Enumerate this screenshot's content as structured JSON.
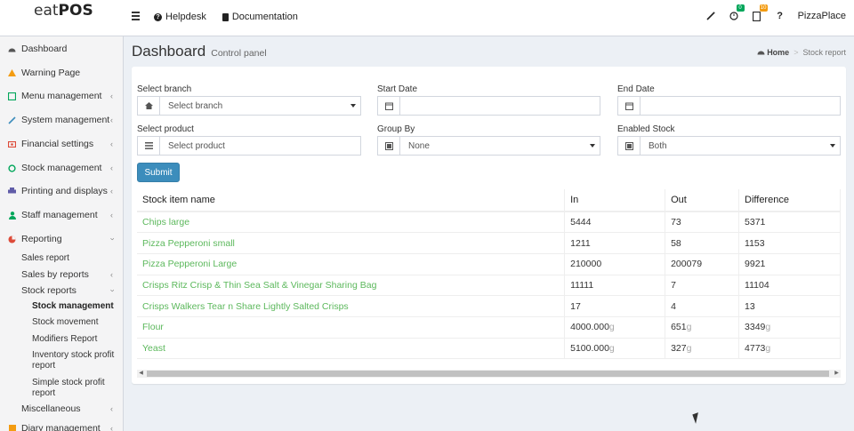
{
  "header": {
    "logo_part1": "eat",
    "logo_part2": "POS",
    "nav": [
      {
        "label": "Helpdesk",
        "icon": "question-circle-icon"
      },
      {
        "label": "Documentation",
        "icon": "book-icon"
      }
    ],
    "notifications_badge": "0",
    "tasks_badge": "10",
    "help_label": "?",
    "account_name": "PizzaPlace"
  },
  "sidebar": {
    "items": [
      {
        "label": "Dashboard",
        "icon": "dashboard-icon",
        "color": "#555555"
      },
      {
        "label": "Warning Page",
        "icon": "warning-icon",
        "color": "#f39c12"
      },
      {
        "label": "Menu management",
        "icon": "menu-icon",
        "color": "#00a65a"
      },
      {
        "label": "System management",
        "icon": "paperclip-icon",
        "color": "#3c8dbc"
      },
      {
        "label": "Financial settings",
        "icon": "money-icon",
        "color": "#dd4b39"
      },
      {
        "label": "Stock management",
        "icon": "refresh-icon",
        "color": "#00a65a"
      },
      {
        "label": "Printing and displays",
        "icon": "print-icon",
        "color": "#605ca8"
      },
      {
        "label": "Staff management",
        "icon": "user-icon",
        "color": "#00a65a"
      },
      {
        "label": "Reporting",
        "icon": "pie-chart-icon",
        "color": "#dd4b39"
      }
    ],
    "reporting_sub": [
      {
        "label": "Sales report"
      },
      {
        "label": "Sales by reports"
      },
      {
        "label": "Stock reports"
      }
    ],
    "stock_reports_sub": [
      {
        "label": "Stock management"
      },
      {
        "label": "Stock movement"
      },
      {
        "label": "Modifiers Report"
      },
      {
        "label": "Inventory stock profit report"
      },
      {
        "label": "Simple stock profit report"
      }
    ],
    "misc_label": "Miscellaneous",
    "diary_label": "Diary management"
  },
  "content": {
    "title": "Dashboard",
    "subtitle": "Control panel",
    "breadcrumb_home": "Home",
    "breadcrumb_current": "Stock report"
  },
  "filters": {
    "branch": {
      "label": "Select branch",
      "value": "Select branch"
    },
    "start_date": {
      "label": "Start Date",
      "value": ""
    },
    "end_date": {
      "label": "End Date",
      "value": ""
    },
    "product": {
      "label": "Select product",
      "value": "Select product"
    },
    "group_by": {
      "label": "Group By",
      "value": "None"
    },
    "enabled_stock": {
      "label": "Enabled Stock",
      "value": "Both"
    },
    "submit_label": "Submit"
  },
  "table": {
    "headers": [
      "Stock item name",
      "In",
      "Out",
      "Difference"
    ],
    "rows": [
      {
        "name": "Chips large",
        "in": "5444",
        "in_unit": "",
        "out": "73",
        "out_unit": "",
        "diff": "5371",
        "diff_unit": ""
      },
      {
        "name": "Pizza Pepperoni small",
        "in": "1211",
        "in_unit": "",
        "out": "58",
        "out_unit": "",
        "diff": "1153",
        "diff_unit": ""
      },
      {
        "name": "Pizza Pepperoni Large",
        "in": "210000",
        "in_unit": "",
        "out": "200079",
        "out_unit": "",
        "diff": "9921",
        "diff_unit": ""
      },
      {
        "name": "Crisps Ritz Crisp & Thin Sea Salt & Vinegar Sharing Bag",
        "in": "11111",
        "in_unit": "",
        "out": "7",
        "out_unit": "",
        "diff": "11104",
        "diff_unit": ""
      },
      {
        "name": "Crisps Walkers Tear n Share Lightly Salted Crisps",
        "in": "17",
        "in_unit": "",
        "out": "4",
        "out_unit": "",
        "diff": "13",
        "diff_unit": ""
      },
      {
        "name": "Flour",
        "in": "4000.000",
        "in_unit": "g",
        "out": "651",
        "out_unit": "g",
        "diff": "3349",
        "diff_unit": "g"
      },
      {
        "name": "Yeast",
        "in": "5100.000",
        "in_unit": "g",
        "out": "327",
        "out_unit": "g",
        "diff": "4773",
        "diff_unit": "g"
      }
    ]
  },
  "colors": {
    "accent": "#3c8dbc",
    "link_green": "#5cb85c"
  }
}
